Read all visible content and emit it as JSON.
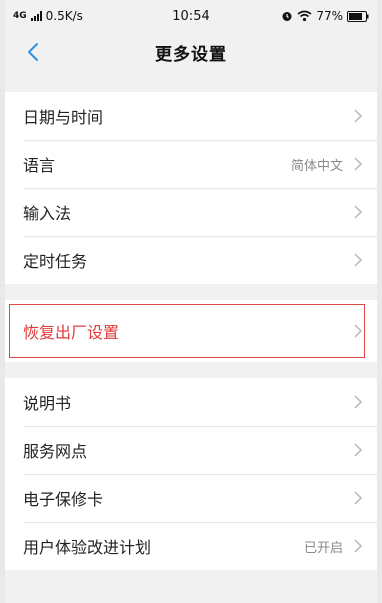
{
  "status_bar": {
    "network": "4G",
    "speed": "0.5K/s",
    "time": "10:54",
    "battery": "77%"
  },
  "header": {
    "title": "更多设置",
    "back_icon": "chevron-left-icon",
    "accent_color": "#2f8fe0"
  },
  "group1": [
    {
      "label": "日期与时间",
      "value": ""
    },
    {
      "label": "语言",
      "value": "简体中文"
    },
    {
      "label": "输入法",
      "value": ""
    },
    {
      "label": "定时任务",
      "value": ""
    }
  ],
  "reset": {
    "label": "恢复出厂设置",
    "color": "#e23b3b"
  },
  "group2": [
    {
      "label": "说明书",
      "value": ""
    },
    {
      "label": "服务网点",
      "value": ""
    },
    {
      "label": "电子保修卡",
      "value": ""
    },
    {
      "label": "用户体验改进计划",
      "value": "已开启"
    }
  ]
}
